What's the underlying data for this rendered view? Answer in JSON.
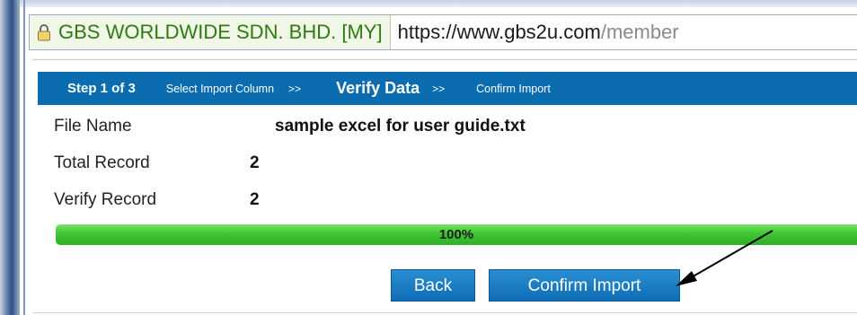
{
  "browser": {
    "identity_label": "GBS WORLDWIDE SDN. BHD. [MY]",
    "url_scheme": "https://",
    "url_host": "www.gbs2u.com",
    "url_path": "/member"
  },
  "steps": {
    "current": "Step 1 of 3",
    "items": [
      {
        "label": "Select Import Column",
        "sep": ">>"
      },
      {
        "label": "Verify Data",
        "sep": ">>",
        "active": true
      },
      {
        "label": "Confirm Import"
      }
    ]
  },
  "info": {
    "file_name_label": "File Name",
    "file_name_value": "sample excel for user guide.txt",
    "total_record_label": "Total Record",
    "total_record_value": "2",
    "verify_record_label": "Verify Record",
    "verify_record_value": "2"
  },
  "progress": {
    "text": "100%",
    "fraction": 1.0
  },
  "buttons": {
    "back_label": "Back",
    "confirm_label": "Confirm Import"
  },
  "colors": {
    "step_bar": "#0b6cb0",
    "progress_green": "#3fc533",
    "button_blue": "#1a7cc4",
    "identity_green": "#2f7a11"
  }
}
